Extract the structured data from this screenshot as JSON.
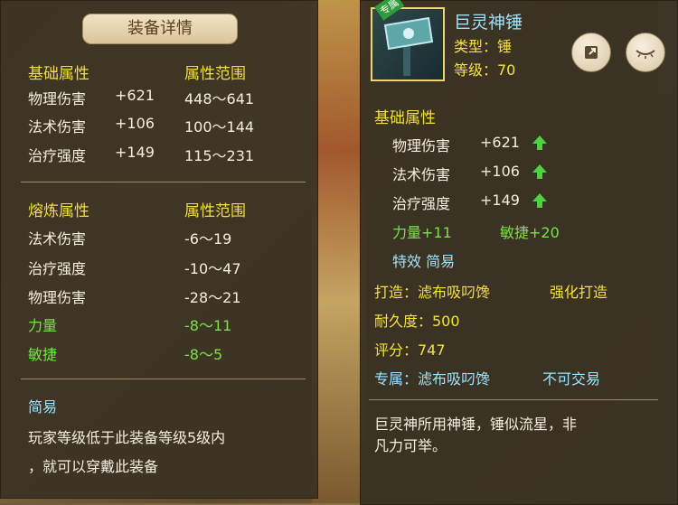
{
  "left": {
    "title": "装备详情",
    "base_header": "基础属性",
    "range_header": "属性范围",
    "base_rows": [
      {
        "name": "物理伤害",
        "value": "+621",
        "range": "448～641"
      },
      {
        "name": "法术伤害",
        "value": "+106",
        "range": "100～144"
      },
      {
        "name": "治疗强度",
        "value": "+149",
        "range": "115～231"
      }
    ],
    "refine_header": "熔炼属性",
    "refine_range_header": "属性范围",
    "refine_rows": [
      {
        "name": "法术伤害",
        "range": "-6～19"
      },
      {
        "name": "治疗强度",
        "range": "-10～47"
      },
      {
        "name": "物理伤害",
        "range": "-28～21"
      }
    ],
    "green_rows": [
      {
        "name": "力量",
        "range": "-8～11"
      },
      {
        "name": "敏捷",
        "range": "-8～5"
      }
    ],
    "effect_title": "简易",
    "effect_desc_1": "玩家等级低于此装备等级5级内",
    "effect_desc_2": "，就可以穿戴此装备"
  },
  "right": {
    "badge": "专属",
    "item_name": "巨灵神锤",
    "type_label": "类型：锤",
    "level_label": "等级：70",
    "base_header": "基础属性",
    "base_rows": [
      {
        "name": "物理伤害",
        "value": "+621"
      },
      {
        "name": "法术伤害",
        "value": "+106"
      },
      {
        "name": "治疗强度",
        "value": "+149"
      }
    ],
    "strength": "力量+11",
    "agility": "敏捷+20",
    "special": "特效 简易",
    "forge": "打造：滤布吸叼馋",
    "forge_type": "强化打造",
    "durability": "耐久度：500",
    "score": "评分：747",
    "exclusive": "专属：滤布吸叼馋",
    "tradeable": "不可交易",
    "desc_1": "巨灵神所用神锤，锤似流星，非",
    "desc_2": "凡力可举。"
  },
  "colors": {
    "header": "#f2df3c",
    "green": "#7ce04a",
    "cyan": "#9ee3ff"
  },
  "icons": [
    "share-icon",
    "eye-icon",
    "up-arrow-icon"
  ]
}
